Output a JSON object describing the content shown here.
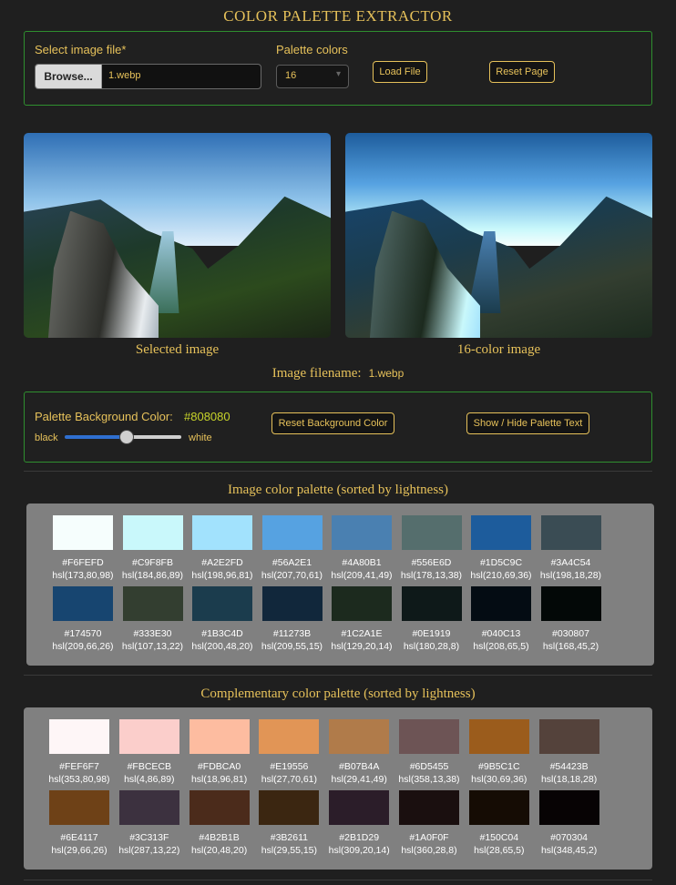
{
  "app": {
    "title": "COLOR PALETTE EXTRACTOR"
  },
  "loader": {
    "file_label": "Select image file*",
    "browse_label": "Browse...",
    "file_name": "1.webp",
    "palette_label": "Palette colors",
    "palette_value": "16",
    "load_button": "Load File",
    "reset_button": "Reset Page"
  },
  "images": {
    "selected_caption": "Selected image",
    "quantized_caption": "16-color image",
    "filename_label": "Image filename:",
    "filename_value": "1.webp"
  },
  "background": {
    "label": "Palette Background Color:",
    "value": "#808080",
    "slider_min_label": "black",
    "slider_max_label": "white",
    "slider_fraction": 0.5,
    "reset_button": "Reset Background Color",
    "toggle_button": "Show / Hide Palette Text"
  },
  "image_palette": {
    "title": "Image color palette (sorted by lightness)",
    "colors": [
      {
        "hex": "#F6FEFD",
        "hsl": "hsl(173,80,98)"
      },
      {
        "hex": "#C9F8FB",
        "hsl": "hsl(184,86,89)"
      },
      {
        "hex": "#A2E2FD",
        "hsl": "hsl(198,96,81)"
      },
      {
        "hex": "#56A2E1",
        "hsl": "hsl(207,70,61)"
      },
      {
        "hex": "#4A80B1",
        "hsl": "hsl(209,41,49)"
      },
      {
        "hex": "#556E6D",
        "hsl": "hsl(178,13,38)"
      },
      {
        "hex": "#1D5C9C",
        "hsl": "hsl(210,69,36)"
      },
      {
        "hex": "#3A4C54",
        "hsl": "hsl(198,18,28)"
      },
      {
        "hex": "#174570",
        "hsl": "hsl(209,66,26)"
      },
      {
        "hex": "#333E30",
        "hsl": "hsl(107,13,22)"
      },
      {
        "hex": "#1B3C4D",
        "hsl": "hsl(200,48,20)"
      },
      {
        "hex": "#11273B",
        "hsl": "hsl(209,55,15)"
      },
      {
        "hex": "#1C2A1E",
        "hsl": "hsl(129,20,14)"
      },
      {
        "hex": "#0E1919",
        "hsl": "hsl(180,28,8)"
      },
      {
        "hex": "#040C13",
        "hsl": "hsl(208,65,5)"
      },
      {
        "hex": "#030807",
        "hsl": "hsl(168,45,2)"
      }
    ]
  },
  "complementary_palette": {
    "title": "Complementary color palette (sorted by lightness)",
    "colors": [
      {
        "hex": "#FEF6F7",
        "hsl": "hsl(353,80,98)"
      },
      {
        "hex": "#FBCECB",
        "hsl": "hsl(4,86,89)"
      },
      {
        "hex": "#FDBCA0",
        "hsl": "hsl(18,96,81)"
      },
      {
        "hex": "#E19556",
        "hsl": "hsl(27,70,61)"
      },
      {
        "hex": "#B07B4A",
        "hsl": "hsl(29,41,49)"
      },
      {
        "hex": "#6D5455",
        "hsl": "hsl(358,13,38)"
      },
      {
        "hex": "#9B5C1C",
        "hsl": "hsl(30,69,36)"
      },
      {
        "hex": "#54423B",
        "hsl": "hsl(18,18,28)"
      },
      {
        "hex": "#6E4117",
        "hsl": "hsl(29,66,26)"
      },
      {
        "hex": "#3C313F",
        "hsl": "hsl(287,13,22)"
      },
      {
        "hex": "#4B2B1B",
        "hsl": "hsl(20,48,20)"
      },
      {
        "hex": "#3B2611",
        "hsl": "hsl(29,55,15)"
      },
      {
        "hex": "#2B1D29",
        "hsl": "hsl(309,20,14)"
      },
      {
        "hex": "#1A0F0F",
        "hsl": "hsl(360,28,8)"
      },
      {
        "hex": "#150C04",
        "hsl": "hsl(28,65,5)"
      },
      {
        "hex": "#070304",
        "hsl": "hsl(348,45,2)"
      }
    ]
  }
}
